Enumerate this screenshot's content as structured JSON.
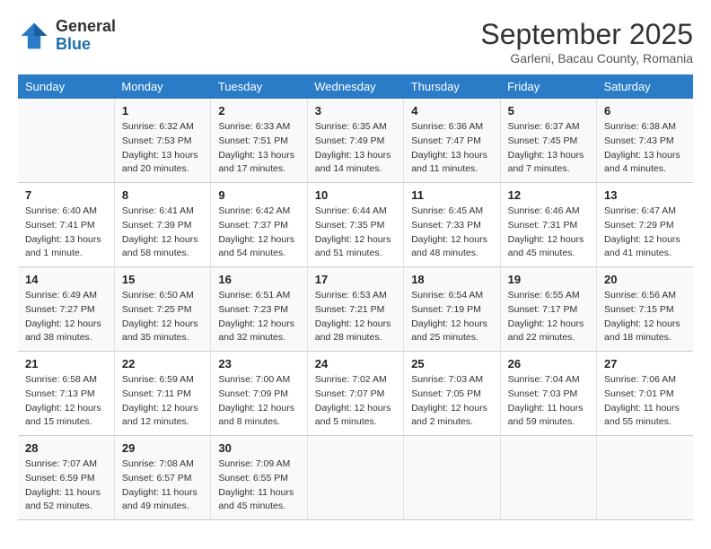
{
  "logo": {
    "line1": "General",
    "line2": "Blue"
  },
  "title": "September 2025",
  "subtitle": "Garleni, Bacau County, Romania",
  "days_header": [
    "Sunday",
    "Monday",
    "Tuesday",
    "Wednesday",
    "Thursday",
    "Friday",
    "Saturday"
  ],
  "weeks": [
    [
      {
        "num": "",
        "info": ""
      },
      {
        "num": "1",
        "info": "Sunrise: 6:32 AM\nSunset: 7:53 PM\nDaylight: 13 hours\nand 20 minutes."
      },
      {
        "num": "2",
        "info": "Sunrise: 6:33 AM\nSunset: 7:51 PM\nDaylight: 13 hours\nand 17 minutes."
      },
      {
        "num": "3",
        "info": "Sunrise: 6:35 AM\nSunset: 7:49 PM\nDaylight: 13 hours\nand 14 minutes."
      },
      {
        "num": "4",
        "info": "Sunrise: 6:36 AM\nSunset: 7:47 PM\nDaylight: 13 hours\nand 11 minutes."
      },
      {
        "num": "5",
        "info": "Sunrise: 6:37 AM\nSunset: 7:45 PM\nDaylight: 13 hours\nand 7 minutes."
      },
      {
        "num": "6",
        "info": "Sunrise: 6:38 AM\nSunset: 7:43 PM\nDaylight: 13 hours\nand 4 minutes."
      }
    ],
    [
      {
        "num": "7",
        "info": "Sunrise: 6:40 AM\nSunset: 7:41 PM\nDaylight: 13 hours\nand 1 minute."
      },
      {
        "num": "8",
        "info": "Sunrise: 6:41 AM\nSunset: 7:39 PM\nDaylight: 12 hours\nand 58 minutes."
      },
      {
        "num": "9",
        "info": "Sunrise: 6:42 AM\nSunset: 7:37 PM\nDaylight: 12 hours\nand 54 minutes."
      },
      {
        "num": "10",
        "info": "Sunrise: 6:44 AM\nSunset: 7:35 PM\nDaylight: 12 hours\nand 51 minutes."
      },
      {
        "num": "11",
        "info": "Sunrise: 6:45 AM\nSunset: 7:33 PM\nDaylight: 12 hours\nand 48 minutes."
      },
      {
        "num": "12",
        "info": "Sunrise: 6:46 AM\nSunset: 7:31 PM\nDaylight: 12 hours\nand 45 minutes."
      },
      {
        "num": "13",
        "info": "Sunrise: 6:47 AM\nSunset: 7:29 PM\nDaylight: 12 hours\nand 41 minutes."
      }
    ],
    [
      {
        "num": "14",
        "info": "Sunrise: 6:49 AM\nSunset: 7:27 PM\nDaylight: 12 hours\nand 38 minutes."
      },
      {
        "num": "15",
        "info": "Sunrise: 6:50 AM\nSunset: 7:25 PM\nDaylight: 12 hours\nand 35 minutes."
      },
      {
        "num": "16",
        "info": "Sunrise: 6:51 AM\nSunset: 7:23 PM\nDaylight: 12 hours\nand 32 minutes."
      },
      {
        "num": "17",
        "info": "Sunrise: 6:53 AM\nSunset: 7:21 PM\nDaylight: 12 hours\nand 28 minutes."
      },
      {
        "num": "18",
        "info": "Sunrise: 6:54 AM\nSunset: 7:19 PM\nDaylight: 12 hours\nand 25 minutes."
      },
      {
        "num": "19",
        "info": "Sunrise: 6:55 AM\nSunset: 7:17 PM\nDaylight: 12 hours\nand 22 minutes."
      },
      {
        "num": "20",
        "info": "Sunrise: 6:56 AM\nSunset: 7:15 PM\nDaylight: 12 hours\nand 18 minutes."
      }
    ],
    [
      {
        "num": "21",
        "info": "Sunrise: 6:58 AM\nSunset: 7:13 PM\nDaylight: 12 hours\nand 15 minutes."
      },
      {
        "num": "22",
        "info": "Sunrise: 6:59 AM\nSunset: 7:11 PM\nDaylight: 12 hours\nand 12 minutes."
      },
      {
        "num": "23",
        "info": "Sunrise: 7:00 AM\nSunset: 7:09 PM\nDaylight: 12 hours\nand 8 minutes."
      },
      {
        "num": "24",
        "info": "Sunrise: 7:02 AM\nSunset: 7:07 PM\nDaylight: 12 hours\nand 5 minutes."
      },
      {
        "num": "25",
        "info": "Sunrise: 7:03 AM\nSunset: 7:05 PM\nDaylight: 12 hours\nand 2 minutes."
      },
      {
        "num": "26",
        "info": "Sunrise: 7:04 AM\nSunset: 7:03 PM\nDaylight: 11 hours\nand 59 minutes."
      },
      {
        "num": "27",
        "info": "Sunrise: 7:06 AM\nSunset: 7:01 PM\nDaylight: 11 hours\nand 55 minutes."
      }
    ],
    [
      {
        "num": "28",
        "info": "Sunrise: 7:07 AM\nSunset: 6:59 PM\nDaylight: 11 hours\nand 52 minutes."
      },
      {
        "num": "29",
        "info": "Sunrise: 7:08 AM\nSunset: 6:57 PM\nDaylight: 11 hours\nand 49 minutes."
      },
      {
        "num": "30",
        "info": "Sunrise: 7:09 AM\nSunset: 6:55 PM\nDaylight: 11 hours\nand 45 minutes."
      },
      {
        "num": "",
        "info": ""
      },
      {
        "num": "",
        "info": ""
      },
      {
        "num": "",
        "info": ""
      },
      {
        "num": "",
        "info": ""
      }
    ]
  ]
}
